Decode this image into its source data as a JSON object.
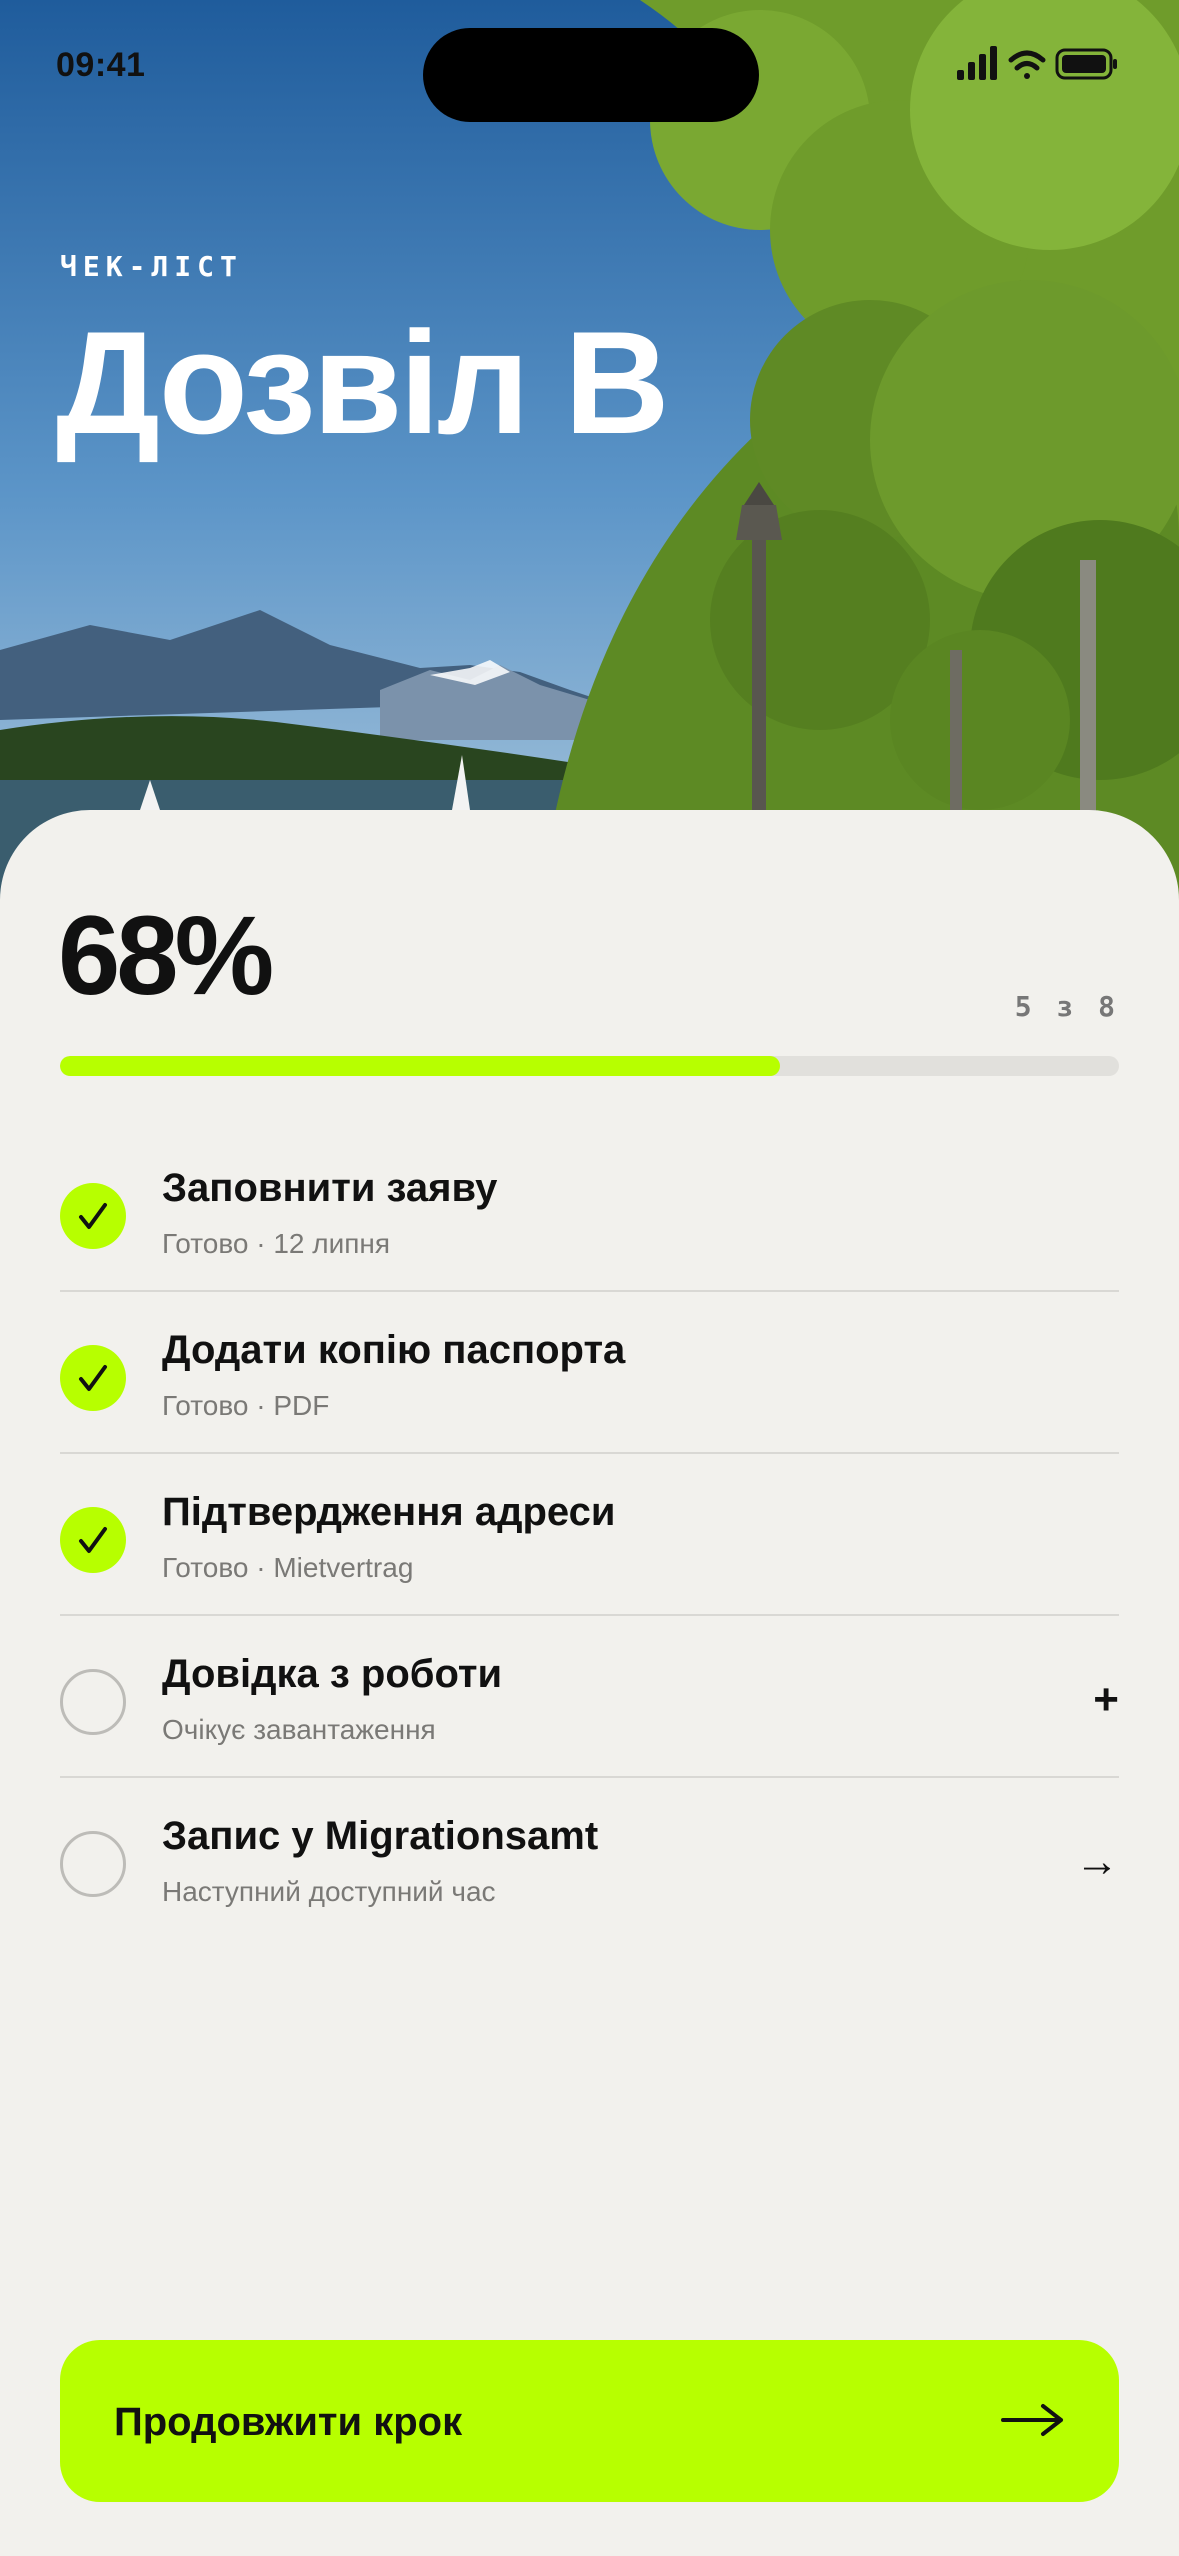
{
  "status_bar": {
    "time": "09:41"
  },
  "header": {
    "kicker": "ЧЕК-ЛІСТ",
    "title": "Дозвіл B"
  },
  "progress": {
    "percent_label": "68%",
    "count_label": "5 з 8",
    "fill_fraction": 0.68
  },
  "checklist": [
    {
      "title": "Заповнити заяву",
      "subtitle": "Готово · 12 липня",
      "done": true,
      "action_icon": ""
    },
    {
      "title": "Додати копію паспорта",
      "subtitle": "Готово · PDF",
      "done": true,
      "action_icon": ""
    },
    {
      "title": "Підтвердження адреси",
      "subtitle": "Готово · Mietvertrag",
      "done": true,
      "action_icon": ""
    },
    {
      "title": "Довідка з роботи",
      "subtitle": "Очікує завантаження",
      "done": false,
      "action_icon": "plus-icon",
      "action_glyph": "+"
    },
    {
      "title": "Запис у Migrationsamt",
      "subtitle": "Наступний доступний час",
      "done": false,
      "action_icon": "arrow-right-icon",
      "action_glyph": "→"
    }
  ],
  "cta": {
    "label": "Продовжити крок"
  },
  "colors": {
    "accent": "#b7ff00",
    "background": "#f2f1ed",
    "text": "#111111",
    "muted": "#7a7976"
  }
}
